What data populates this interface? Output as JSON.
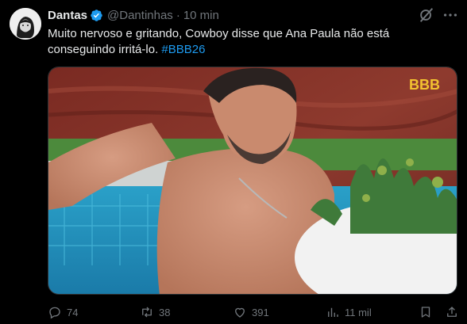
{
  "tweet": {
    "author_name": "Dantas",
    "handle": "@Dantinhas",
    "separator": "·",
    "time": "10 min",
    "text_main": "Muito nervoso e gritando, Cowboy disse que Ana Paula não está conseguindo irritá-lo. ",
    "hashtag": "#BBB26"
  },
  "media": {
    "watermark": "BBB"
  },
  "actions": {
    "replies": "74",
    "retweets": "38",
    "likes": "391",
    "views": "11 mil"
  },
  "colors": {
    "background": "#000000",
    "text": "#e7e9ea",
    "muted": "#71767b",
    "accent": "#1d9bf0",
    "watermark": "#f2c230"
  },
  "icons": [
    "avatar",
    "verified-badge-icon",
    "grok-icon",
    "more-icon",
    "reply-icon",
    "retweet-icon",
    "like-icon",
    "views-icon",
    "bookmark-icon",
    "share-icon"
  ]
}
